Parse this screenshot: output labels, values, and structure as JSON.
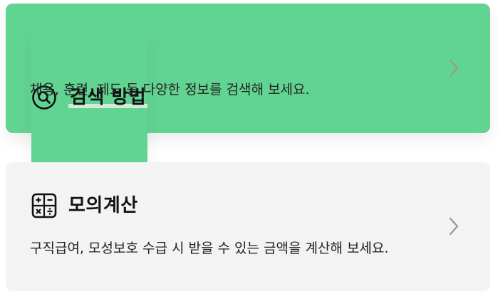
{
  "cards": [
    {
      "title": "검색 방법",
      "description": "채용, 훈련, 제도 등 다양한 정보를 검색해 보세요.",
      "icon": "search-icon",
      "background": "#62d492"
    },
    {
      "title": "모의계산",
      "description": "구직급여, 모성보호 수급 시 받을 수 있는 금액을 계산해 보세요.",
      "icon": "calculator-icon",
      "background": "#f3f3f4"
    }
  ],
  "colors": {
    "accent_green": "#62d492",
    "card_gray": "#f3f3f4",
    "chevron": "#9a9a9a",
    "text": "#111111"
  }
}
